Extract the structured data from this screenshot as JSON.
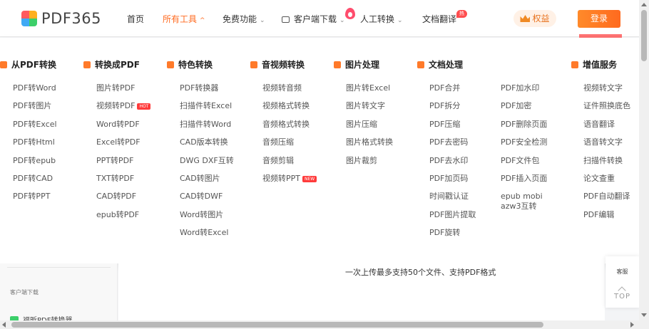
{
  "brand": {
    "name": "PDF365",
    "logo_icon": "pdf365-logo-icon"
  },
  "nav": {
    "home": "首页",
    "all_tools": "所有工具",
    "free": "免费功能",
    "client_download": "客户端下载",
    "manual": "人工转换",
    "translate": "文档翻译",
    "hot_tag": "热门",
    "quanyi": "权益",
    "login": "登录"
  },
  "columns": [
    {
      "title": "从PDF转换",
      "items": [
        "PDF转Word",
        "PDF转图片",
        "PDF转Excel",
        "PDF转Html",
        "PDF转epub",
        "PDF转CAD",
        "PDF转PPT"
      ]
    },
    {
      "title": "转换成PDF",
      "items": [
        "图片转PDF",
        "视频转PDF",
        "Word转PDF",
        "Excel转PDF",
        "PPT转PDF",
        "TXT转PDF",
        "CAD转PDF",
        "epub转PDF"
      ],
      "badge_item": 1,
      "badge": "HOT"
    },
    {
      "title": "特色转换",
      "items": [
        "PDF转换器",
        "扫描件转Excel",
        "扫描件转Word",
        "CAD版本转换",
        "DWG DXF互转",
        "CAD转图片",
        "CAD转DWF",
        "Word转图片",
        "Word转Excel"
      ]
    },
    {
      "title": "音视频转换",
      "items": [
        "视频转音频",
        "视频格式转换",
        "音频格式转换",
        "音频压缩",
        "音频剪辑",
        "视频转PPT"
      ],
      "badge_item": 5,
      "badge": "NEW"
    },
    {
      "title": "图片处理",
      "items": [
        "图片转Excel",
        "图片转文字",
        "图片压缩",
        "图片格式转换",
        "图片裁剪"
      ]
    },
    {
      "title": "文档处理",
      "items": [
        "PDF合并",
        "PDF拆分",
        "PDF压缩",
        "PDF去密码",
        "PDF去水印",
        "PDF加页码",
        "时间戳认证",
        "PDF图片提取",
        "PDF旋转"
      ]
    },
    {
      "title": "",
      "items": [
        "PDF加水印",
        "PDF加密",
        "PDF删除页面",
        "PDF安全检测",
        "PDF文件包",
        "PDF插入页面",
        "epub mobi azw3互转"
      ]
    },
    {
      "title": "增值服务",
      "items": [
        "视频转文字",
        "证件照换底色",
        "语音翻译",
        "语音转文字",
        "扫描件转换",
        "论文查重",
        "PDF自动翻译",
        "PDF编辑"
      ]
    }
  ],
  "sidebar": {
    "label": "客户端下载",
    "item": "福昕PDF转换器"
  },
  "upload_note": "一次上传最多支持50个文件、支持PDF格式",
  "float": {
    "kefu": "客服",
    "top": "TOP"
  },
  "colors": {
    "accent": "#ff6a1f",
    "badge": "#ff3b3b"
  }
}
